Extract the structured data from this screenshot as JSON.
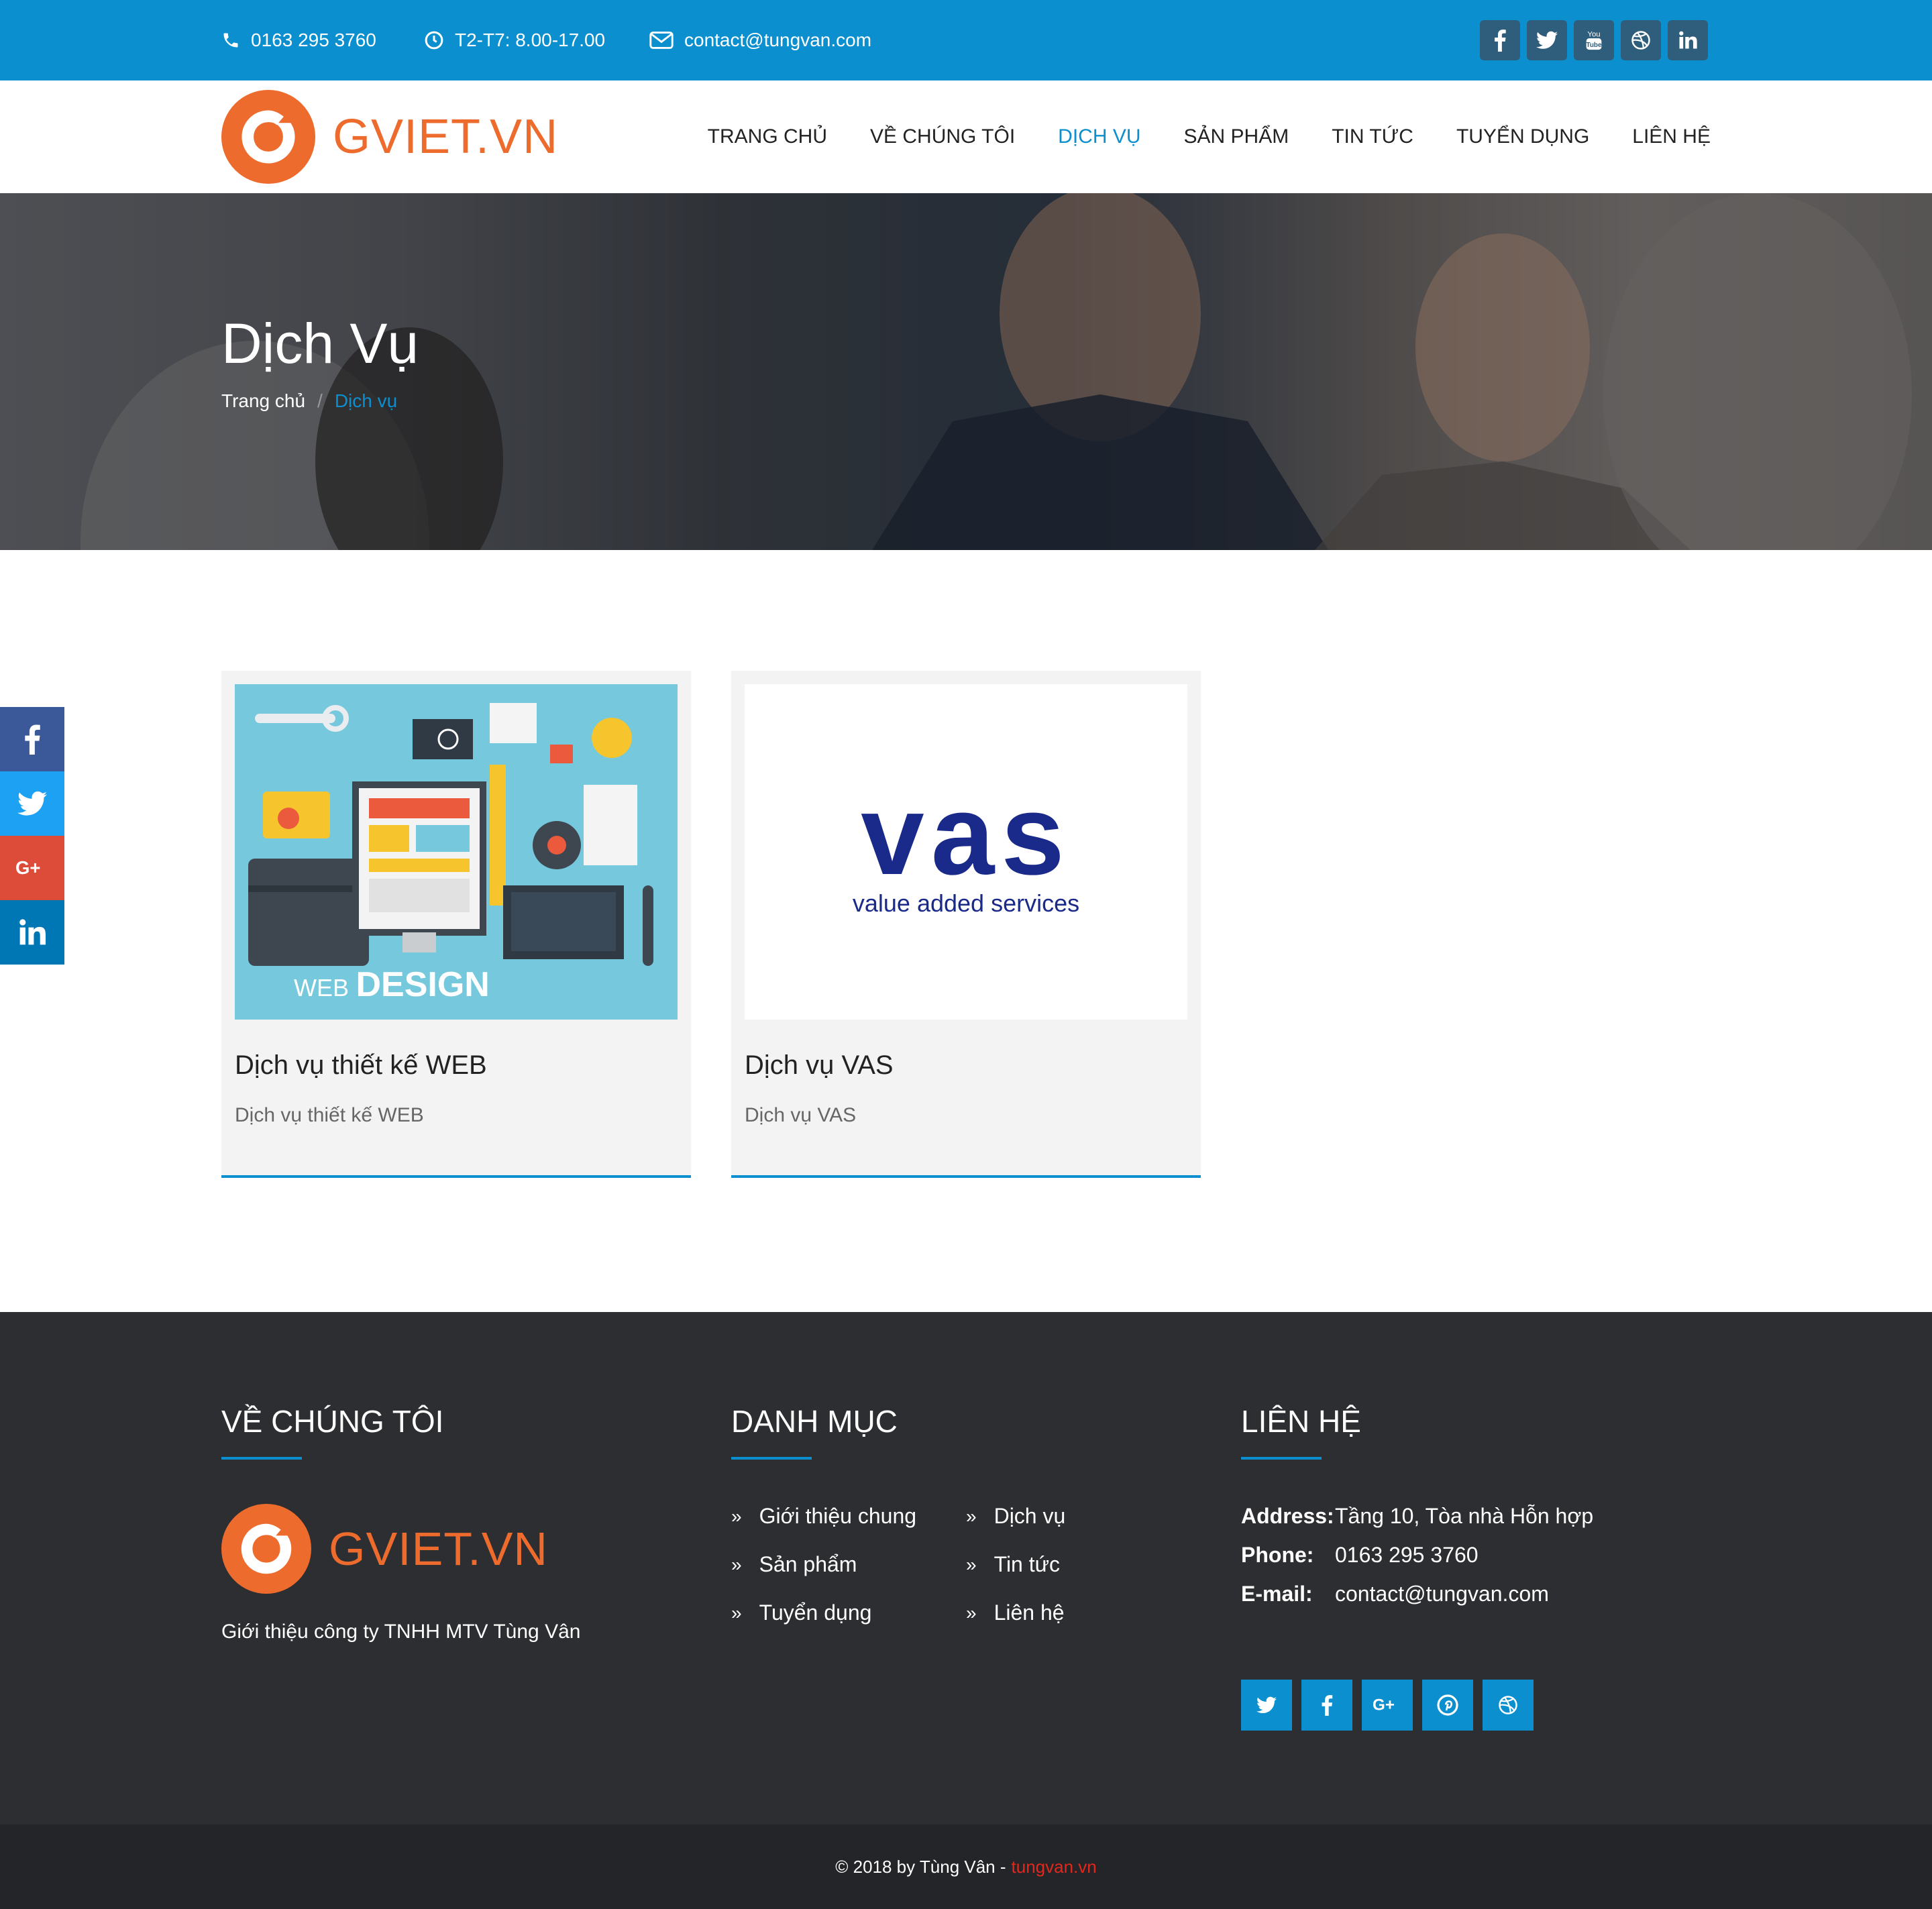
{
  "topbar": {
    "phone": "0163 295 3760",
    "hours": "T2-T7: 8.00-17.00",
    "email": "contact@tungvan.com",
    "social": [
      "facebook-icon",
      "twitter-icon",
      "youtube-icon",
      "dribbble-icon",
      "linkedin-icon"
    ]
  },
  "header": {
    "logo_text": "GVIET.VN",
    "nav": [
      {
        "label": "TRANG CHỦ",
        "active": false
      },
      {
        "label": "VỀ CHÚNG TÔI",
        "active": false
      },
      {
        "label": "DỊCH VỤ",
        "active": true
      },
      {
        "label": "SẢN PHẨM",
        "active": false
      },
      {
        "label": "TIN TỨC",
        "active": false
      },
      {
        "label": "TUYỂN DỤNG",
        "active": false
      },
      {
        "label": "LIÊN HỆ",
        "active": false
      }
    ]
  },
  "hero": {
    "title": "Dịch Vụ",
    "breadcrumb": {
      "home": "Trang chủ",
      "separator": "/",
      "current": "Dịch vụ"
    }
  },
  "side_share": [
    "facebook-icon",
    "twitter-icon",
    "google-plus-icon",
    "linkedin-icon"
  ],
  "cards": [
    {
      "title": "Dịch vụ thiết kế WEB",
      "desc": "Dịch vụ thiết kế WEB",
      "image_caption": "DESIGN",
      "image_caption_prefix": "WEB"
    },
    {
      "title": "Dịch vụ VAS",
      "desc": "Dịch vụ VAS",
      "image_caption": "vas",
      "image_caption_sub": "value added services"
    }
  ],
  "footer": {
    "about_title": "VỀ CHÚNG TÔI",
    "about_logo_text": "GVIET.VN",
    "about_text": "Giới thiệu công ty TNHH MTV Tùng Vân",
    "menu_title": "DANH MỤC",
    "menu": [
      "Giới thiệu chung",
      "Dịch vụ",
      "Sản phẩm",
      "Tin tức",
      "Tuyển dụng",
      "Liên hệ"
    ],
    "contact_title": "LIÊN HỆ",
    "contact": {
      "address_label": "Address:",
      "address": "Tầng 10, Tòa nhà Hỗn hợp",
      "phone_label": "Phone:",
      "phone": "0163 295 3760",
      "email_label": "E-mail:",
      "email": "contact@tungvan.com"
    },
    "social": [
      "twitter-icon",
      "facebook-icon",
      "google-plus-icon",
      "pinterest-icon",
      "dribbble-icon"
    ]
  },
  "copyright": {
    "text": "© 2018 by Tùng Vân -",
    "brand": "tungvan.vn"
  },
  "colors": {
    "primary": "#0b8fce",
    "logo_orange": "#ed6b2d",
    "footer_bg": "#2d2e31",
    "copyright_red": "#e2271c"
  }
}
